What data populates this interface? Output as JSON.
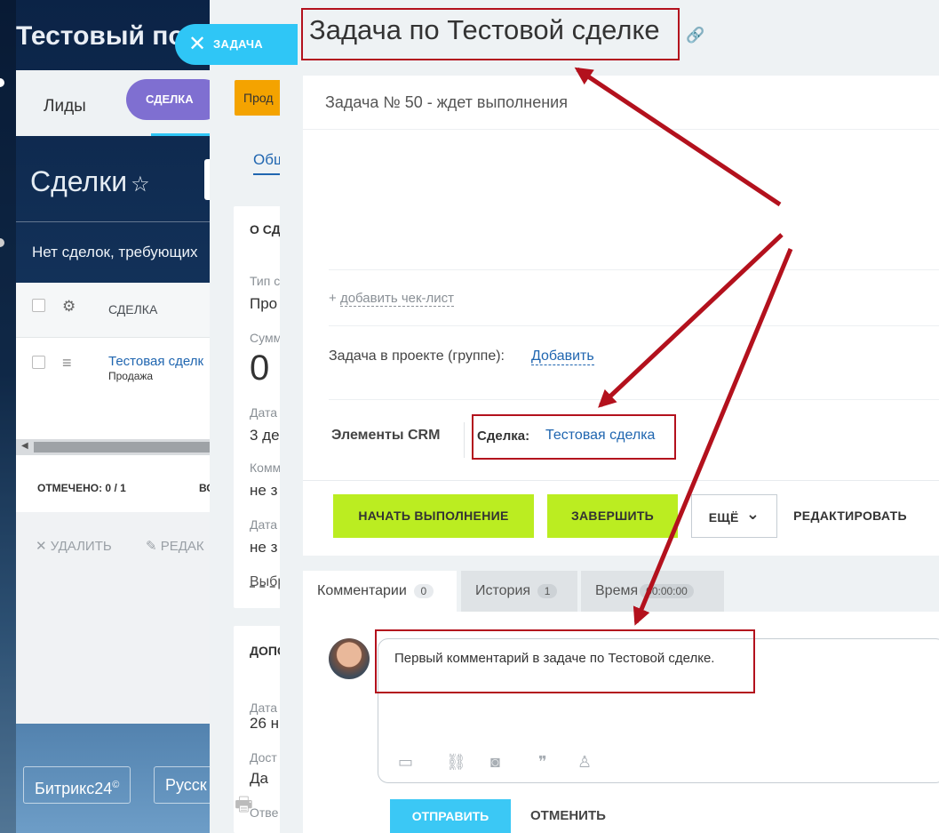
{
  "background": {
    "portal_title": "Тестовый пор",
    "tabs": {
      "leads": "Лиды",
      "deal": "СДЕЛКА"
    },
    "deals_title": "Сделки",
    "star_icon": "☆",
    "no_deals": "Нет сделок, требующих",
    "grid": {
      "col_deal": "СДЕЛКА",
      "row_link": "Тестовая сделк",
      "row_sub": "Продажа",
      "marked": "ОТМЕЧЕНО: 0 / 1",
      "marked2": "ВС"
    },
    "actions": {
      "delete": "✕ УДАЛИТЬ",
      "edit": "✎ РЕДАК"
    },
    "footer": {
      "brand": "Битрикс24",
      "brand_mark": "©",
      "lang": "Русск"
    }
  },
  "deal": {
    "stage": "Прод",
    "tab_general": "Общ",
    "card1": {
      "section": "О СД",
      "type_label": "Тип с",
      "type_value": "Про",
      "sum_label": "Сумм",
      "sum_value": "0",
      "date_label": "Дата",
      "date_value": "3 де",
      "comment_label": "Комм",
      "comment_value": "не з",
      "date2_label": "Дата",
      "date2_value": "не з",
      "choose": "Выбр"
    },
    "card2": {
      "section": "ДОПО",
      "date_label": "Дата",
      "date_value": "26 н",
      "avail_label": "Дост",
      "avail_value": "Да",
      "resp_label": "Отве"
    },
    "print_icon": "🖶"
  },
  "task": {
    "close_label": "ЗАДАЧА",
    "close_icon": "✕",
    "title": "Задача по Тестовой сделке",
    "title_link_icon": "🔗",
    "status": "Задача № 50 - ждет выполнения",
    "add_checklist_plus": "+",
    "add_checklist": "добавить чек-лист",
    "project_label": "Задача в проекте (группе):",
    "project_add": "Добавить",
    "crm_label": "Элементы CRM",
    "crm_deal_label": "Сделка:",
    "crm_deal_link": "Тестовая сделка",
    "buttons": {
      "start": "НАЧАТЬ ВЫПОЛНЕНИЕ",
      "finish": "ЗАВЕРШИТЬ",
      "more": "ЕЩЁ",
      "more_icon": "⌄",
      "edit": "РЕДАКТИРОВАТЬ"
    },
    "tabs": [
      {
        "label": "Комментарии",
        "count": "0"
      },
      {
        "label": "История",
        "count": "1"
      },
      {
        "label": "Время",
        "count": "00:00:00"
      }
    ],
    "comment_text": "Первый комментарий в задаче по Тестовой сделке.",
    "editor_icons": [
      "▭",
      "⛓",
      "◙",
      "❞",
      "♙"
    ],
    "send": "ОТПРАВИТЬ",
    "cancel": "ОТМЕНИТЬ"
  },
  "colors": {
    "accent_blue": "#2fc6f6",
    "green_button": "#bbed21",
    "annotation_red": "#b3111d",
    "link_blue": "#2066b0"
  }
}
